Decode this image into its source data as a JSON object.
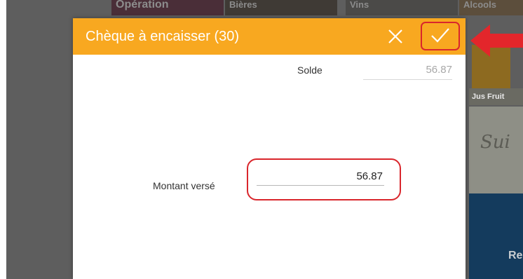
{
  "background": {
    "categories": [
      "Opération",
      "Bières",
      "Vins",
      "Alcools"
    ],
    "tile_label": "Jus Fruit",
    "paper_script": "Sui",
    "button_fragment": "Re"
  },
  "dialog": {
    "title": "Chèque à encaisser (30)",
    "cancel_icon": "close-icon",
    "confirm_icon": "check-icon",
    "balance_label": "Solde",
    "balance_value": "56.87",
    "amount_label": "Montant versé",
    "amount_value": "56.87"
  },
  "colors": {
    "header": "#f8a820",
    "highlight": "#d9262c",
    "overlay": "#5e5e5e"
  }
}
